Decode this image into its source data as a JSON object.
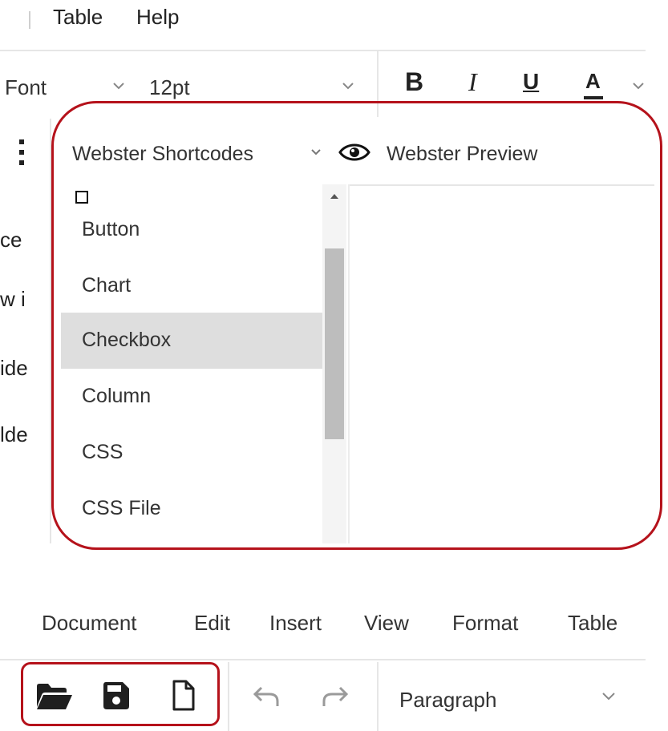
{
  "top_menu": {
    "table_label": "Table",
    "help_label": "Help"
  },
  "format_bar": {
    "font_label": "Font",
    "size_value": "12pt",
    "bold": "B",
    "italic": "I",
    "underline": "U",
    "font_color": "A"
  },
  "left_text": [
    "ce",
    "w i",
    "ide",
    "lde"
  ],
  "webster_bar": {
    "shortcodes_label": "Webster Shortcodes",
    "preview_label": "Webster Preview"
  },
  "dropdown": {
    "items": [
      {
        "label": "Button"
      },
      {
        "label": "Chart"
      },
      {
        "label": "Checkbox"
      },
      {
        "label": "Column"
      },
      {
        "label": "CSS"
      },
      {
        "label": "CSS File"
      }
    ]
  },
  "bottom_menu": {
    "items": [
      "Document",
      "Edit",
      "Insert",
      "View",
      "Format",
      "Table"
    ]
  },
  "bottom_toolbar": {
    "block_format": "Paragraph",
    "icons": [
      "folder-open-icon",
      "save-icon",
      "new-file-icon",
      "undo-icon",
      "redo-icon"
    ]
  },
  "colors": {
    "callout": "#b5121b",
    "highlight": "#dedede"
  }
}
